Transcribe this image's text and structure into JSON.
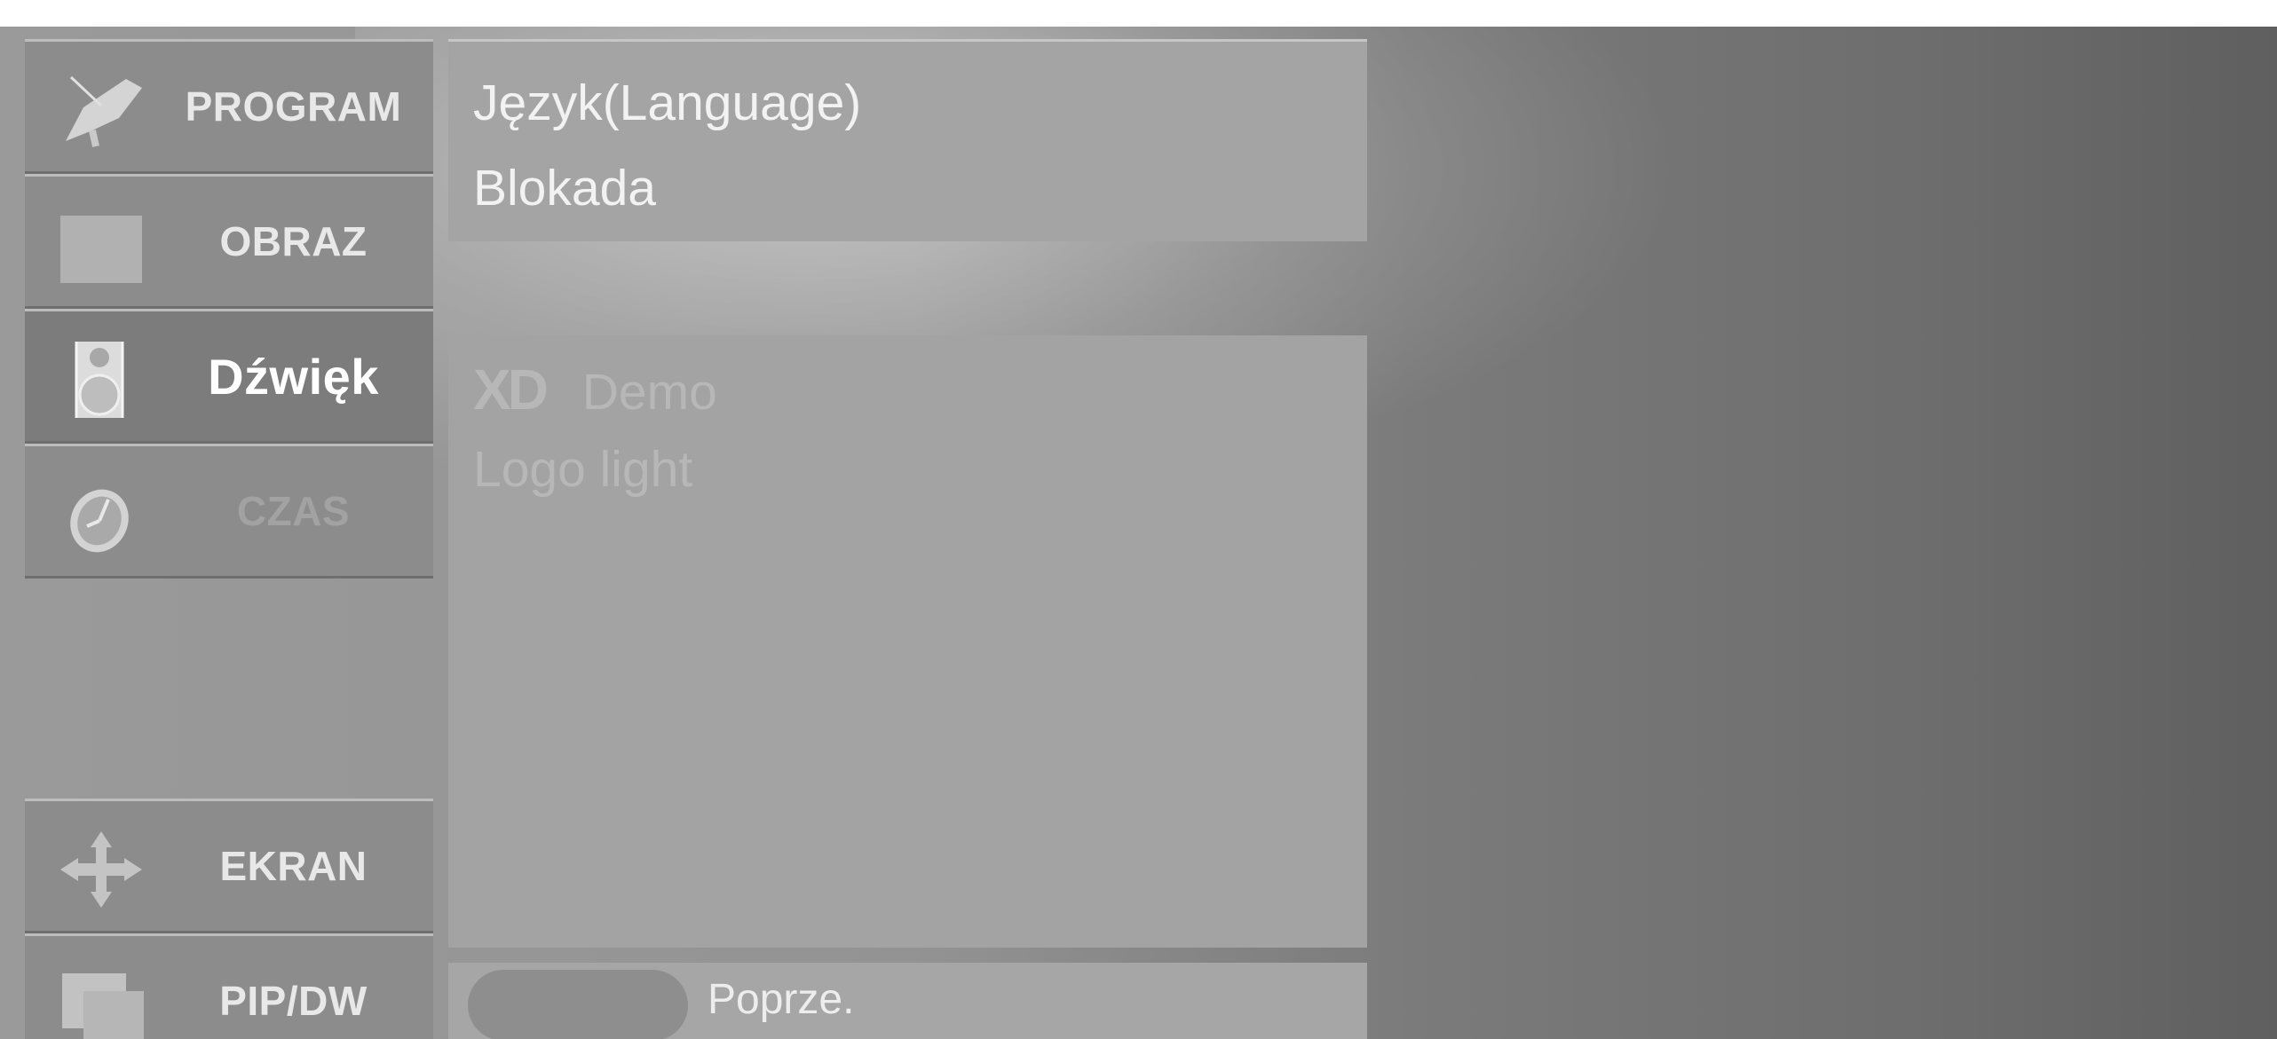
{
  "sidebar": {
    "items": [
      {
        "label": "PROGRAM",
        "icon": "satellite-dish-icon"
      },
      {
        "label": "OBRAZ",
        "icon": "picture-square-icon"
      },
      {
        "label": "Dźwięk",
        "icon": "speaker-icon",
        "active": true
      },
      {
        "label": "CZAS",
        "icon": "clock-icon"
      },
      {
        "label": "EKRAN",
        "icon": "move-arrows-icon"
      },
      {
        "label": "PIP/DW",
        "icon": "pip-squares-icon"
      }
    ]
  },
  "menu": {
    "items": [
      "Język(Language)",
      "Blokada"
    ]
  },
  "submenu": {
    "xd_logo": "XD",
    "demo": "Demo",
    "logo_light": "Logo light"
  },
  "footer": {
    "prev_label": "Poprze."
  },
  "colors": {
    "panel": "#a4a4a4",
    "sidebar_item": "#8c8c8c",
    "background": "#7b7b7b"
  }
}
